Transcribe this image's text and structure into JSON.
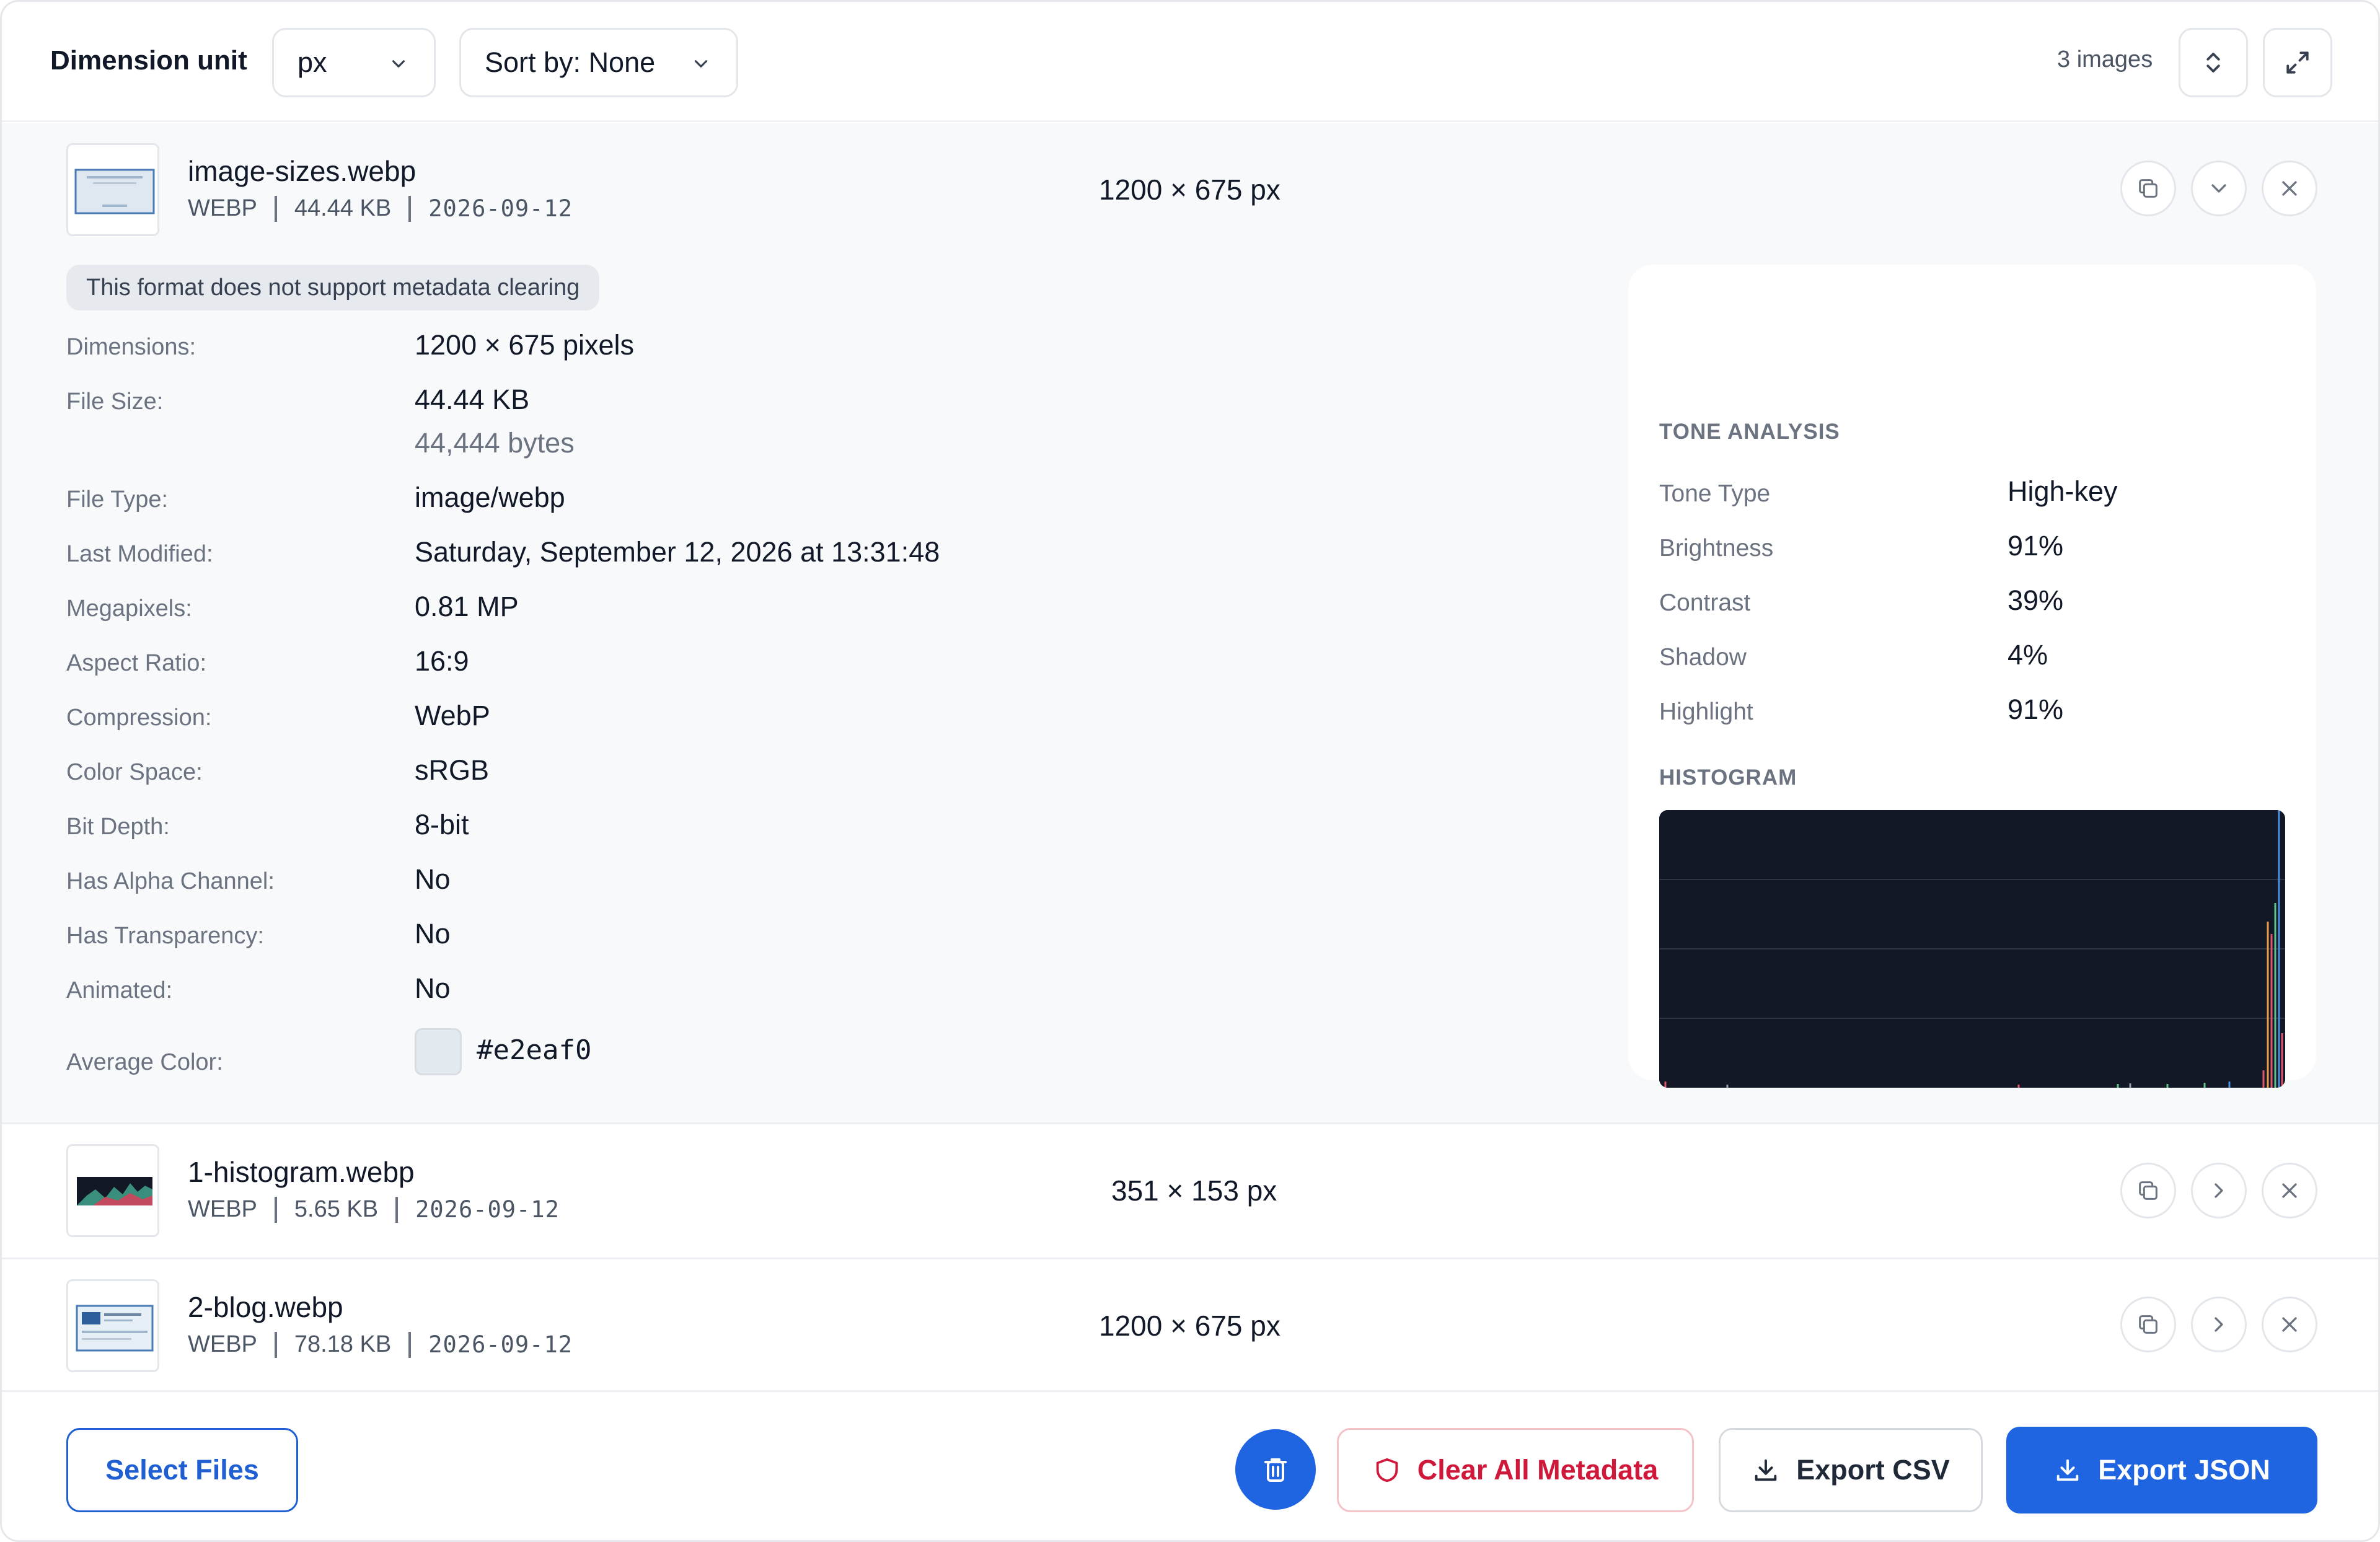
{
  "toolbar": {
    "dimension_unit_label": "Dimension unit",
    "unit_value": "px",
    "sort_value": "Sort by: None",
    "image_count": "3 images"
  },
  "files": [
    {
      "name": "image-sizes.webp",
      "format": "WEBP",
      "size": "44.44 KB",
      "date": "2026-09-12",
      "dimensions": "1200 × 675 px",
      "expanded": true
    },
    {
      "name": "1-histogram.webp",
      "format": "WEBP",
      "size": "5.65 KB",
      "date": "2026-09-12",
      "dimensions": "351 × 153 px",
      "expanded": false
    },
    {
      "name": "2-blog.webp",
      "format": "WEBP",
      "size": "78.18 KB",
      "date": "2026-09-12",
      "dimensions": "1200 × 675 px",
      "expanded": false
    }
  ],
  "details": {
    "notice": "This format does not support metadata clearing",
    "rows": [
      {
        "label": "Dimensions:",
        "value": "1200 × 675 pixels"
      },
      {
        "label": "File Size:",
        "value": "44.44 KB",
        "sub": "44,444 bytes"
      },
      {
        "label": "File Type:",
        "value": "image/webp"
      },
      {
        "label": "Last Modified:",
        "value": "Saturday, September 12, 2026 at 13:31:48"
      },
      {
        "label": "Megapixels:",
        "value": "0.81 MP"
      },
      {
        "label": "Aspect Ratio:",
        "value": "16:9"
      },
      {
        "label": "Compression:",
        "value": "WebP"
      },
      {
        "label": "Color Space:",
        "value": "sRGB"
      },
      {
        "label": "Bit Depth:",
        "value": "8-bit"
      },
      {
        "label": "Has Alpha Channel:",
        "value": "No"
      },
      {
        "label": "Has Transparency:",
        "value": "No"
      },
      {
        "label": "Animated:",
        "value": "No"
      },
      {
        "label": "Average Color:",
        "value": "#e2eaf0"
      }
    ],
    "average_color": "#e2eaf0"
  },
  "tone": {
    "title": "TONE ANALYSIS",
    "rows": [
      {
        "label": "Tone Type",
        "value": "High-key"
      },
      {
        "label": "Brightness",
        "value": "91%"
      },
      {
        "label": "Contrast",
        "value": "39%"
      },
      {
        "label": "Shadow",
        "value": "4%"
      },
      {
        "label": "Highlight",
        "value": "91%"
      }
    ],
    "histogram_title": "HISTOGRAM"
  },
  "actions": {
    "select_files": "Select Files",
    "clear_all": "Clear All Metadata",
    "export_csv": "Export CSV",
    "export_json": "Export JSON"
  },
  "colors": {
    "primary": "#1f64e0",
    "danger": "#d0183a",
    "histogram_bg": "#131826"
  }
}
